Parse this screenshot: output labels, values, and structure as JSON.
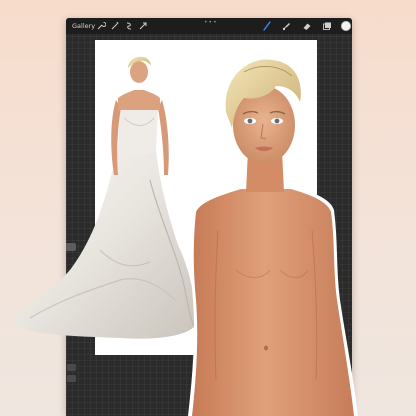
{
  "toolbar": {
    "gallery_label": "Gallery",
    "left_icons": [
      "wrench-icon",
      "magic-wand-icon",
      "selection-icon",
      "transform-arrow-icon"
    ],
    "right_icons": [
      "brush-icon",
      "smudge-icon",
      "eraser-icon",
      "layers-icon"
    ],
    "brush_accent": "#3c8cf0",
    "current_color": "#f2f2f2"
  },
  "colors": {
    "background_top": "#f7dccc",
    "tablet": "#2b2b2c",
    "canvas": "#ffffff",
    "dress": "#ece9e4",
    "skin": "#d9916c",
    "hair": "#e7d59e"
  }
}
